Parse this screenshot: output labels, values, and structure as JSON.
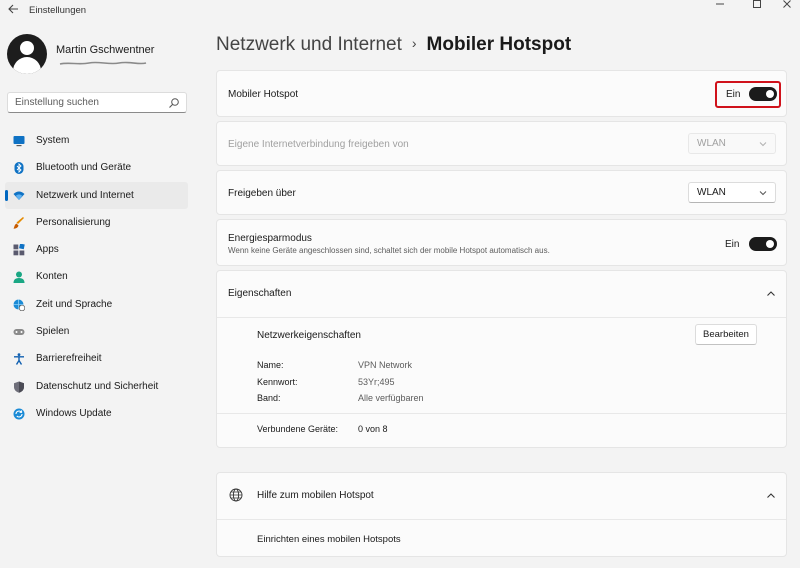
{
  "window": {
    "title": "Einstellungen"
  },
  "profile": {
    "name": "Martin Gschwentner"
  },
  "search": {
    "placeholder": "Einstellung suchen"
  },
  "sidebar": {
    "items": [
      {
        "label": "System",
        "icon": "monitor-icon"
      },
      {
        "label": "Bluetooth und Geräte",
        "icon": "bluetooth-icon"
      },
      {
        "label": "Netzwerk und Internet",
        "icon": "wifi-icon",
        "active": true
      },
      {
        "label": "Personalisierung",
        "icon": "brush-icon"
      },
      {
        "label": "Apps",
        "icon": "apps-icon"
      },
      {
        "label": "Konten",
        "icon": "person-icon"
      },
      {
        "label": "Zeit und Sprache",
        "icon": "globe-clock-icon"
      },
      {
        "label": "Spielen",
        "icon": "gamepad-icon"
      },
      {
        "label": "Barrierefreiheit",
        "icon": "accessibility-icon"
      },
      {
        "label": "Datenschutz und Sicherheit",
        "icon": "shield-icon"
      },
      {
        "label": "Windows Update",
        "icon": "update-icon"
      }
    ]
  },
  "breadcrumb": {
    "parent": "Netzwerk und Internet",
    "separator": "›",
    "current": "Mobiler Hotspot"
  },
  "hotspot": {
    "label": "Mobiler Hotspot",
    "toggle_text": "Ein",
    "on": true
  },
  "share_from": {
    "label": "Eigene Internetverbindung freigeben von",
    "value": "WLAN"
  },
  "share_over": {
    "label": "Freigeben über",
    "value": "WLAN"
  },
  "power_saving": {
    "label": "Energiesparmodus",
    "description": "Wenn keine Geräte angeschlossen sind, schaltet sich der mobile Hotspot automatisch aus.",
    "toggle_text": "Ein",
    "on": true
  },
  "properties": {
    "header": "Eigenschaften",
    "section_title": "Netzwerkeigenschaften",
    "edit_button": "Bearbeiten",
    "name_label": "Name:",
    "name_value": "VPN Network",
    "password_label": "Kennwort:",
    "password_value": "53Yr;495",
    "band_label": "Band:",
    "band_value": "Alle verfügbaren",
    "devices_label": "Verbundene Geräte:",
    "devices_value": "0 von 8"
  },
  "help": {
    "header": "Hilfe zum mobilen Hotspot",
    "link": "Einrichten eines mobilen Hotspots"
  },
  "colors": {
    "accent": "#0067c0",
    "highlight": "#d0121b",
    "toggle_on": "#1b1b1b"
  }
}
